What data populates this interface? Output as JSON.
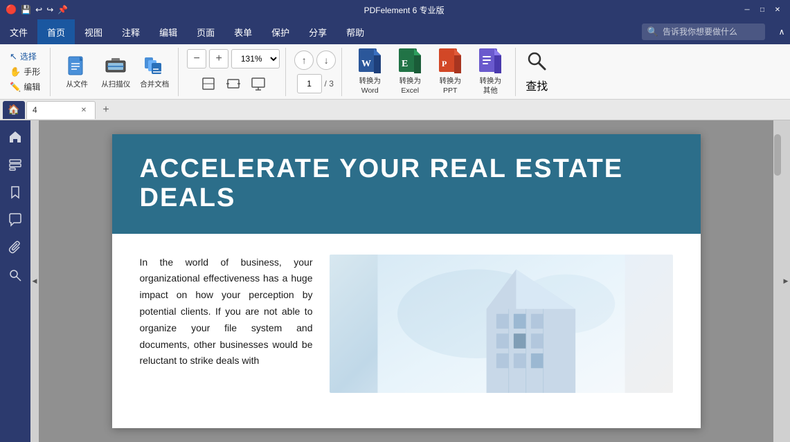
{
  "titlebar": {
    "title": "PDFelement 6 专业版",
    "minimize": "─",
    "maximize": "□",
    "close": "✕"
  },
  "menubar": {
    "items": [
      "文件",
      "首页",
      "视图",
      "注释",
      "编辑",
      "页面",
      "表单",
      "保护",
      "分享",
      "帮助"
    ],
    "active": "首页",
    "search_placeholder": "告诉我你想要做什么",
    "collapse": "∧"
  },
  "toolbar": {
    "select_label": "选择",
    "hand_label": "手形",
    "edit_label": "编辑",
    "from_file_label": "从文件",
    "from_scanner_label": "从扫描仪",
    "merge_label": "合并文档",
    "zoom_value": "131%",
    "page_current": "1",
    "page_total": "3",
    "convert_word_label": "转换为\nWord",
    "convert_excel_label": "转换为\nExcel",
    "convert_ppt_label": "转换为\nPPT",
    "convert_other_label": "转换为\n其他",
    "search_label": "查找"
  },
  "tabbar": {
    "doc_tab_name": "4",
    "add_tab": "+"
  },
  "sidebar": {
    "icons": [
      "home",
      "layers",
      "bookmark",
      "comment",
      "paperclip",
      "search"
    ]
  },
  "pdf": {
    "header_text": "ACCELERATE YOUR REAL ESTATE DEALS",
    "body_text": "In the world of business, your organizational effectiveness has a huge impact on how your perception by potential clients. If you are not able to organize your file system and documents, other businesses would be reluctant to strike deals with"
  },
  "colors": {
    "primary": "#2c3a6e",
    "secondary": "#1a57a0",
    "banner_bg": "#2c6e8a",
    "word_color": "#2b579a",
    "excel_color": "#217346",
    "ppt_color": "#d24726",
    "other_color": "#7b68ee"
  }
}
